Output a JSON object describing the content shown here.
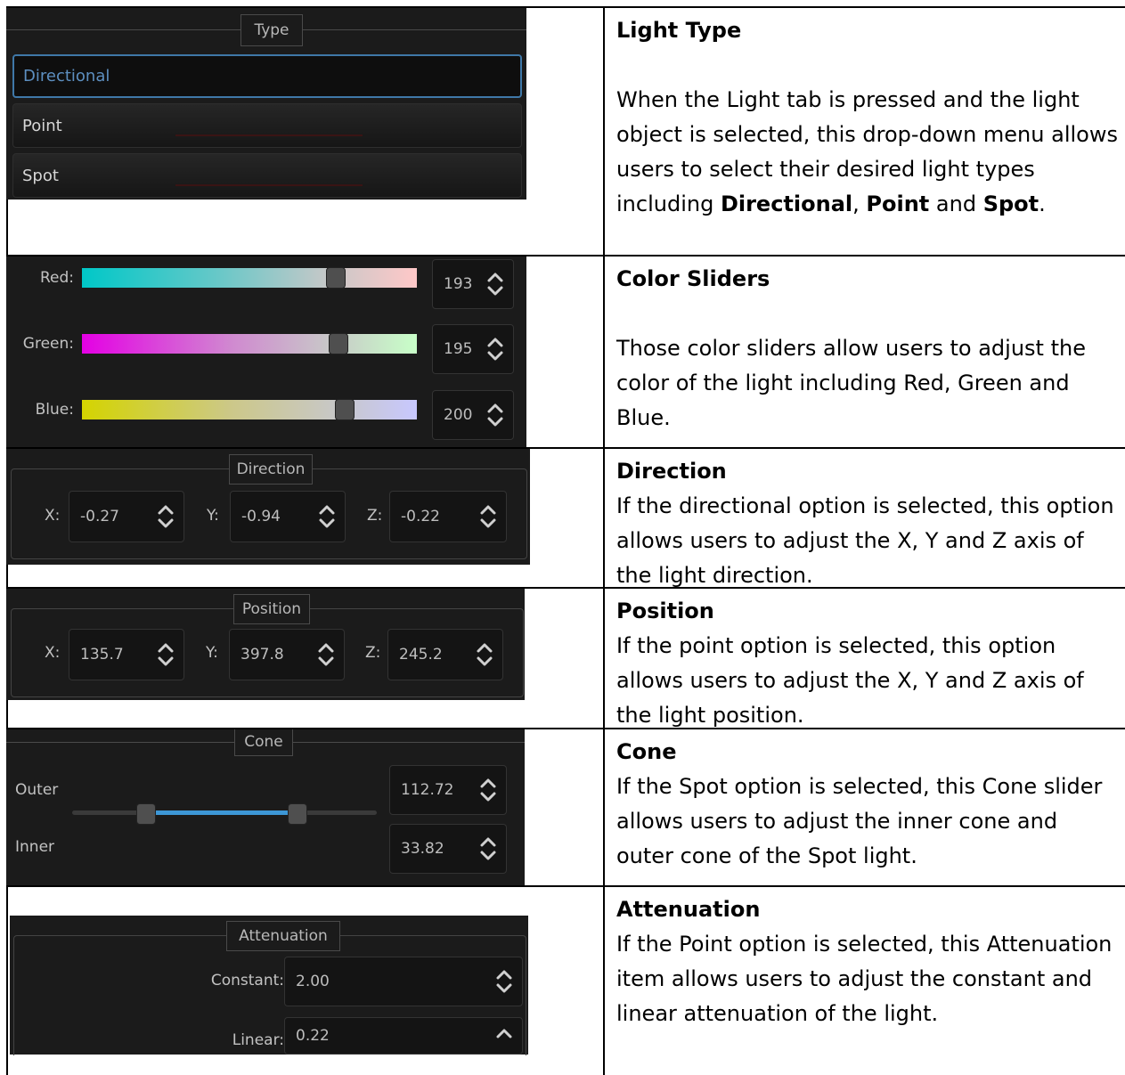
{
  "type_group": {
    "title": "Type",
    "options": [
      "Directional",
      "Point",
      "Spot"
    ],
    "selected": "Directional"
  },
  "color_group": {
    "red_label": "Red:",
    "red_value": "193",
    "red_fraction": 0.757,
    "green_label": "Green:",
    "green_value": "195",
    "green_fraction": 0.765,
    "blue_label": "Blue:",
    "blue_value": "200",
    "blue_fraction": 0.784
  },
  "direction_group": {
    "title": "Direction",
    "x_label": "X:",
    "x_value": "-0.27",
    "y_label": "Y:",
    "y_value": "-0.94",
    "z_label": "Z:",
    "z_value": "-0.22"
  },
  "position_group": {
    "title": "Position",
    "x_label": "X:",
    "x_value": "135.7",
    "y_label": "Y:",
    "y_value": "397.8",
    "z_label": "Z:",
    "z_value": "245.2"
  },
  "cone_group": {
    "title": "Cone",
    "outer_label": "Outer",
    "outer_value": "112.72",
    "inner_label": "Inner",
    "inner_value": "33.82"
  },
  "attenuation_group": {
    "title": "Attenuation",
    "constant_label": "Constant:",
    "constant_value": "2.00",
    "linear_label": "Linear:",
    "linear_value": "0.22"
  },
  "descriptions": {
    "light_type": {
      "heading": "Light Type",
      "text_before": "When the Light tab is pressed and the light object is selected, this drop-down menu allows users to select their desired light types including ",
      "bold1": "Directional",
      "sep1": ", ",
      "bold2": "Point",
      "sep2": " and ",
      "bold3": "Spot",
      "end": "."
    },
    "color_sliders": {
      "heading": "Color Sliders",
      "text": "Those color sliders allow users to adjust the color of the light including Red, Green and Blue."
    },
    "direction": {
      "heading": "Direction",
      "text": "If the directional option is selected, this option allows users to adjust the X, Y and Z axis of the light direction."
    },
    "position": {
      "heading": "Position",
      "text": "If the point option is selected, this option allows users to adjust the X, Y and Z axis of the light position."
    },
    "cone": {
      "heading": "Cone",
      "text": "If the Spot option is selected, this Cone slider allows users to adjust the inner cone and outer cone of the Spot light."
    },
    "attenuation": {
      "heading": "Attenuation",
      "text": "If the Point option is selected, this Attenuation item allows users to adjust the constant and linear attenuation of the light."
    }
  }
}
